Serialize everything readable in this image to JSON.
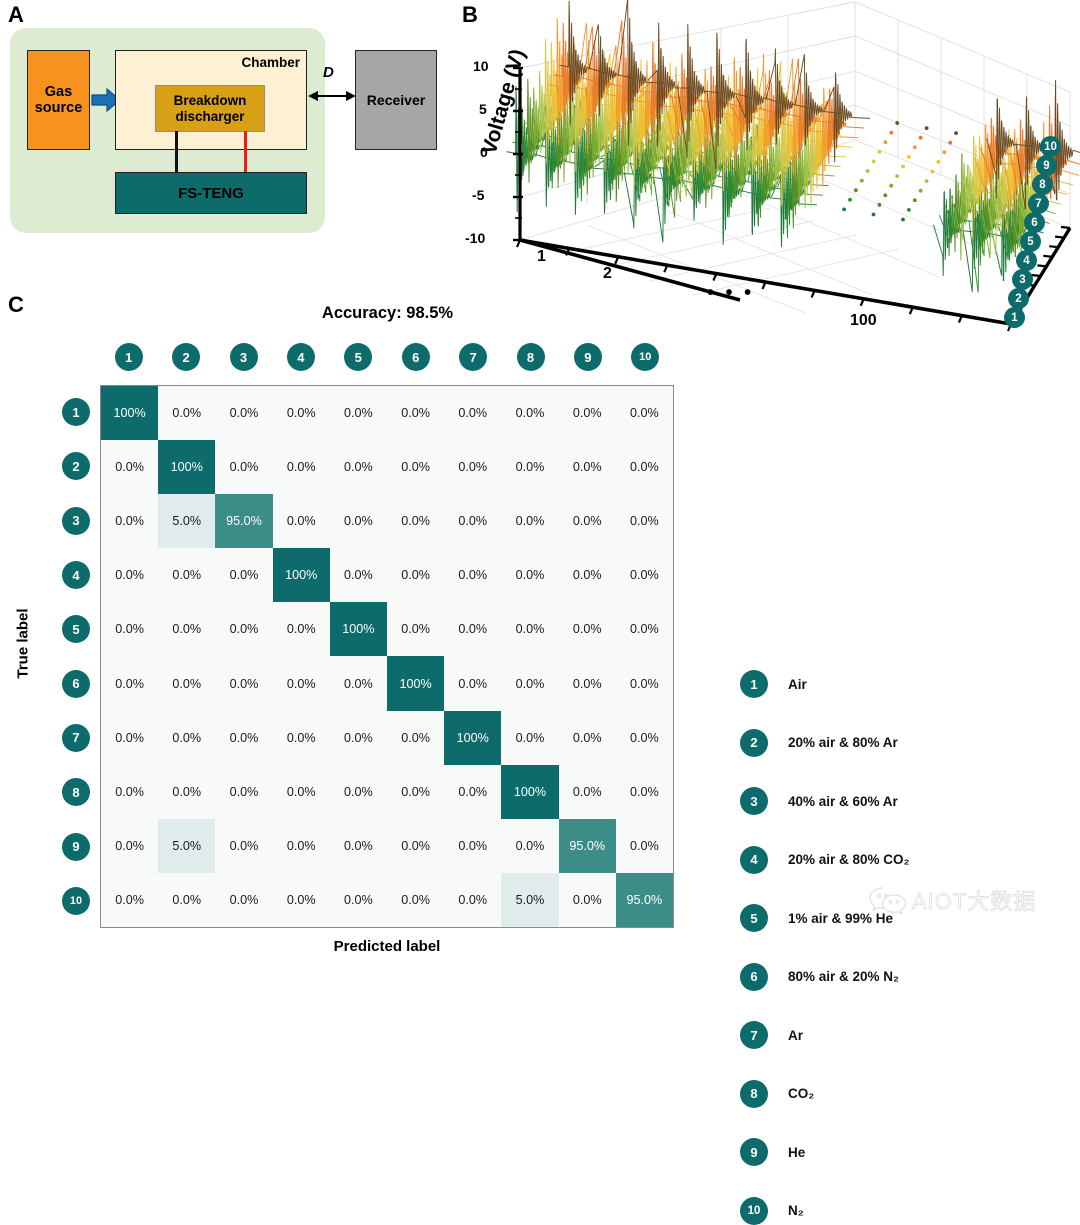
{
  "panels": {
    "a": {
      "letter": "A",
      "gas_source": "Gas\nsource",
      "gas_source_line1": "Gas",
      "gas_source_line2": "source",
      "chamber_label": "Chamber",
      "discharger_line1": "Breakdown",
      "discharger_line2": "discharger",
      "teng_label": "FS-TENG",
      "receiver_label": "Receiver",
      "distance_label": "D",
      "colors": {
        "background": "#ddecd0",
        "gas_source": "#f7921e",
        "chamber": "#fdf0d3",
        "discharger": "#d6a017",
        "teng": "#0e6b6b",
        "receiver": "#a6a6a6",
        "arrow_blue": "#1a6fb5",
        "wire_red": "#ee1b1b",
        "wire_black": "#111111"
      }
    },
    "b": {
      "letter": "B",
      "ylabel": "Voltage (V)",
      "yticks": [
        "10",
        "5",
        "0",
        "-5",
        "-10"
      ],
      "xticks": [
        "1",
        "2",
        "100"
      ],
      "x_ellipsis": "• • •",
      "zticks": [
        "1",
        "2",
        "3",
        "4",
        "5",
        "6",
        "7",
        "8",
        "9",
        "10"
      ],
      "series_colors": [
        "#1f7a3a",
        "#2f8c2f",
        "#5d8f24",
        "#7fae33",
        "#a7c44a",
        "#d7c64a",
        "#f0c02e",
        "#f29a2b",
        "#e8792a",
        "#6d4a22"
      ]
    },
    "c": {
      "letter": "C",
      "title": "Accuracy: 98.5%",
      "xlabel": "Predicted label",
      "ylabel": "True label",
      "colors": {
        "cell_max": "#0d6b6b",
        "cell_95": "#3c8c88",
        "cell_5": "#dfeceb",
        "cell_0": "#f7faf9",
        "border": "#8a8a8a",
        "badge": "#0d6b6b"
      }
    }
  },
  "legend": {
    "items": [
      {
        "id": "1",
        "label": "Air"
      },
      {
        "id": "2",
        "label": "20% air & 80% Ar"
      },
      {
        "id": "3",
        "label": "40% air & 60% Ar"
      },
      {
        "id": "4",
        "label": "20% air & 80% CO₂"
      },
      {
        "id": "5",
        "label": "1% air & 99% He"
      },
      {
        "id": "6",
        "label": "80% air & 20% N₂"
      },
      {
        "id": "7",
        "label": "Ar"
      },
      {
        "id": "8",
        "label": "CO₂"
      },
      {
        "id": "9",
        "label": "He"
      },
      {
        "id": "10",
        "label": "N₂"
      }
    ]
  },
  "watermark": {
    "icon": "wechat-icon",
    "text": "AIOT大数据"
  },
  "chart_data": [
    {
      "type": "heatmap",
      "name": "confusion-matrix",
      "title": "Accuracy: 98.5%",
      "xlabel": "Predicted label",
      "ylabel": "True label",
      "categories": [
        "1",
        "2",
        "3",
        "4",
        "5",
        "6",
        "7",
        "8",
        "9",
        "10"
      ],
      "row_labels": [
        "1",
        "2",
        "3",
        "4",
        "5",
        "6",
        "7",
        "8",
        "9",
        "10"
      ],
      "col_labels": [
        "1",
        "2",
        "3",
        "4",
        "5",
        "6",
        "7",
        "8",
        "9",
        "10"
      ],
      "unit": "%",
      "values": [
        [
          100.0,
          0.0,
          0.0,
          0.0,
          0.0,
          0.0,
          0.0,
          0.0,
          0.0,
          0.0
        ],
        [
          0.0,
          100.0,
          0.0,
          0.0,
          0.0,
          0.0,
          0.0,
          0.0,
          0.0,
          0.0
        ],
        [
          0.0,
          5.0,
          95.0,
          0.0,
          0.0,
          0.0,
          0.0,
          0.0,
          0.0,
          0.0
        ],
        [
          0.0,
          0.0,
          0.0,
          100.0,
          0.0,
          0.0,
          0.0,
          0.0,
          0.0,
          0.0
        ],
        [
          0.0,
          0.0,
          0.0,
          0.0,
          100.0,
          0.0,
          0.0,
          0.0,
          0.0,
          0.0
        ],
        [
          0.0,
          0.0,
          0.0,
          0.0,
          0.0,
          100.0,
          0.0,
          0.0,
          0.0,
          0.0
        ],
        [
          0.0,
          0.0,
          0.0,
          0.0,
          0.0,
          0.0,
          100.0,
          0.0,
          0.0,
          0.0
        ],
        [
          0.0,
          0.0,
          0.0,
          0.0,
          0.0,
          0.0,
          0.0,
          100.0,
          0.0,
          0.0
        ],
        [
          0.0,
          5.0,
          0.0,
          0.0,
          0.0,
          0.0,
          0.0,
          0.0,
          95.0,
          0.0
        ],
        [
          0.0,
          0.0,
          0.0,
          0.0,
          0.0,
          0.0,
          0.0,
          5.0,
          0.0,
          95.0
        ]
      ],
      "display": [
        [
          "100%",
          "0.0%",
          "0.0%",
          "0.0%",
          "0.0%",
          "0.0%",
          "0.0%",
          "0.0%",
          "0.0%",
          "0.0%"
        ],
        [
          "0.0%",
          "100%",
          "0.0%",
          "0.0%",
          "0.0%",
          "0.0%",
          "0.0%",
          "0.0%",
          "0.0%",
          "0.0%"
        ],
        [
          "0.0%",
          "5.0%",
          "95.0%",
          "0.0%",
          "0.0%",
          "0.0%",
          "0.0%",
          "0.0%",
          "0.0%",
          "0.0%"
        ],
        [
          "0.0%",
          "0.0%",
          "0.0%",
          "100%",
          "0.0%",
          "0.0%",
          "0.0%",
          "0.0%",
          "0.0%",
          "0.0%"
        ],
        [
          "0.0%",
          "0.0%",
          "0.0%",
          "0.0%",
          "100%",
          "0.0%",
          "0.0%",
          "0.0%",
          "0.0%",
          "0.0%"
        ],
        [
          "0.0%",
          "0.0%",
          "0.0%",
          "0.0%",
          "0.0%",
          "100%",
          "0.0%",
          "0.0%",
          "0.0%",
          "0.0%"
        ],
        [
          "0.0%",
          "0.0%",
          "0.0%",
          "0.0%",
          "0.0%",
          "0.0%",
          "100%",
          "0.0%",
          "0.0%",
          "0.0%"
        ],
        [
          "0.0%",
          "0.0%",
          "0.0%",
          "0.0%",
          "0.0%",
          "0.0%",
          "0.0%",
          "100%",
          "0.0%",
          "0.0%"
        ],
        [
          "0.0%",
          "5.0%",
          "0.0%",
          "0.0%",
          "0.0%",
          "0.0%",
          "0.0%",
          "0.0%",
          "95.0%",
          "0.0%"
        ],
        [
          "0.0%",
          "0.0%",
          "0.0%",
          "0.0%",
          "0.0%",
          "0.0%",
          "0.0%",
          "5.0%",
          "0.0%",
          "95.0%"
        ]
      ],
      "colorscale": [
        "#f7faf9",
        "#0d6b6b"
      ],
      "vmin": 0,
      "vmax": 100,
      "grid": false,
      "legend_position": "right"
    },
    {
      "type": "line",
      "name": "voltage-waterfall-3d",
      "title": "",
      "xlabel": "",
      "ylabel": "Voltage (V)",
      "zlabel": "",
      "ylim": [
        -10,
        10
      ],
      "yticks": [
        10,
        5,
        0,
        -5,
        -10
      ],
      "x_tick_labels": [
        "1",
        "2",
        "100"
      ],
      "x_note": "100 discharge events per gas, ellipsis between 2 and 100",
      "z_tick_labels": [
        "1",
        "2",
        "3",
        "4",
        "5",
        "6",
        "7",
        "8",
        "9",
        "10"
      ],
      "series": [
        {
          "name": "1",
          "color": "#1f7a3a",
          "peak": 9.0,
          "description": "damped oscillation bursts"
        },
        {
          "name": "2",
          "color": "#2f8c2f",
          "peak": 8.0,
          "description": "damped oscillation bursts"
        },
        {
          "name": "3",
          "color": "#5d8f24",
          "peak": 7.5,
          "description": "damped oscillation bursts"
        },
        {
          "name": "4",
          "color": "#7fae33",
          "peak": 8.5,
          "description": "damped oscillation bursts"
        },
        {
          "name": "5",
          "color": "#a7c44a",
          "peak": 7.0,
          "description": "damped oscillation bursts"
        },
        {
          "name": "6",
          "color": "#d7c64a",
          "peak": 9.5,
          "description": "damped oscillation bursts"
        },
        {
          "name": "7",
          "color": "#f0c02e",
          "peak": 8.0,
          "description": "damped oscillation bursts"
        },
        {
          "name": "8",
          "color": "#f29a2b",
          "peak": 9.0,
          "description": "damped oscillation bursts"
        },
        {
          "name": "9",
          "color": "#e8792a",
          "peak": 8.5,
          "description": "damped oscillation bursts"
        },
        {
          "name": "10",
          "color": "#6d4a22",
          "peak": 10.0,
          "description": "damped oscillation bursts"
        }
      ],
      "grid": true,
      "legend_position": "right"
    }
  ]
}
